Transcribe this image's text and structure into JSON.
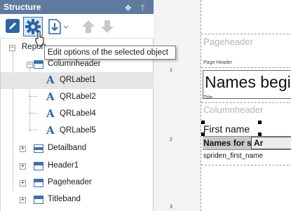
{
  "panel": {
    "title": "Structure",
    "pin_glyph": "✥",
    "pin2_glyph": "ᛘ"
  },
  "toolbar": {
    "edit_icon": "pencil-icon",
    "options_icon": "gear-icon",
    "import_icon": "import-icon",
    "up_icon": "arrow-up-icon",
    "down_icon": "arrow-down-icon"
  },
  "tooltip": {
    "text": "Edit options of the selected object"
  },
  "tree": {
    "expander_minus": "−",
    "expander_plus": "+",
    "items": [
      {
        "label": "Report",
        "kind": "report"
      },
      {
        "label": "Columnheader",
        "kind": "band"
      },
      {
        "label": "QRLabel1",
        "kind": "label",
        "selected": true
      },
      {
        "label": "QRLabel2",
        "kind": "label"
      },
      {
        "label": "QRLabel4",
        "kind": "label"
      },
      {
        "label": "QRLabel5",
        "kind": "label"
      },
      {
        "label": "Detailband",
        "kind": "band"
      },
      {
        "label": "Header1",
        "kind": "band"
      },
      {
        "label": "Pageheader",
        "kind": "band"
      },
      {
        "label": "Titleband",
        "kind": "band"
      }
    ]
  },
  "designer": {
    "ruler_top": "1",
    "ruler_marks": [
      "1",
      "2",
      "3"
    ],
    "pageheader_caption": "Pageheader",
    "pageheader_small": "Page Header",
    "title_text": "Names begi",
    "title_small": "Title",
    "columnheader_caption": "Columnheader",
    "first_name": "First name",
    "state_label": "Names for state:",
    "state_value": "Ar",
    "field_name": "spriden_first_name"
  },
  "colors": {
    "panel_title_bg": "#5e7b9e",
    "accent": "#2a6cc1",
    "icon_blue": "#2d64a8"
  }
}
